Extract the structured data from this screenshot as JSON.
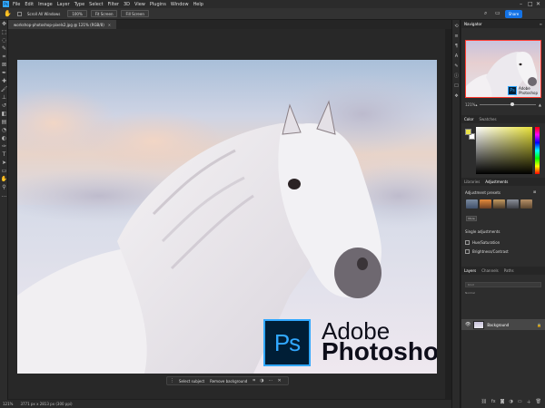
{
  "menu": [
    "File",
    "Edit",
    "Image",
    "Layer",
    "Type",
    "Select",
    "Filter",
    "3D",
    "View",
    "Plugins",
    "Window",
    "Help"
  ],
  "options": {
    "zoom_value": "100%",
    "fit_label": "Fit Screen",
    "fill_label": "Fill Screen",
    "scroll_label": "Scroll All Windows",
    "share_label": "Share"
  },
  "document": {
    "tab_title": "workshop-photoshop-pixels2.jpg @ 121% (RGB/8)",
    "status": "121%",
    "doc_info": "3771 px x 2813 px (300 ppi)"
  },
  "artwork": {
    "brand_line1": "Adobe",
    "brand_line2": "Photoshop",
    "ps_mark": "Ps"
  },
  "context_bar": {
    "select_subject": "Select subject",
    "remove_background": "Remove background"
  },
  "panels": {
    "navigator_tab": "Navigator",
    "nav_zoom": "121%",
    "nav_ps": "Ps",
    "nav_brand1": "Adobe",
    "nav_brand2": "Photoshop",
    "color_tab": "Color",
    "swatches_tab": "Swatches",
    "libraries_tab": "Libraries",
    "adjustments_tab": "Adjustments",
    "adjustment_presets": "Adjustment presets",
    "more_label": "More",
    "single_adjustments": "Single adjustments",
    "hue_saturation": "Hue/Saturation",
    "brightness_contrast": "Brightness/Contrast",
    "layers_tab": "Layers",
    "channels_tab": "Channels",
    "paths_tab": "Paths",
    "layer_kind": "Kind",
    "blend_mode": "Normal",
    "layer_name": "Background"
  },
  "colors": {
    "accent": "#31a8ff",
    "foreground": "#e9e34a",
    "background": "#ffffff",
    "share": "#1473e6"
  }
}
